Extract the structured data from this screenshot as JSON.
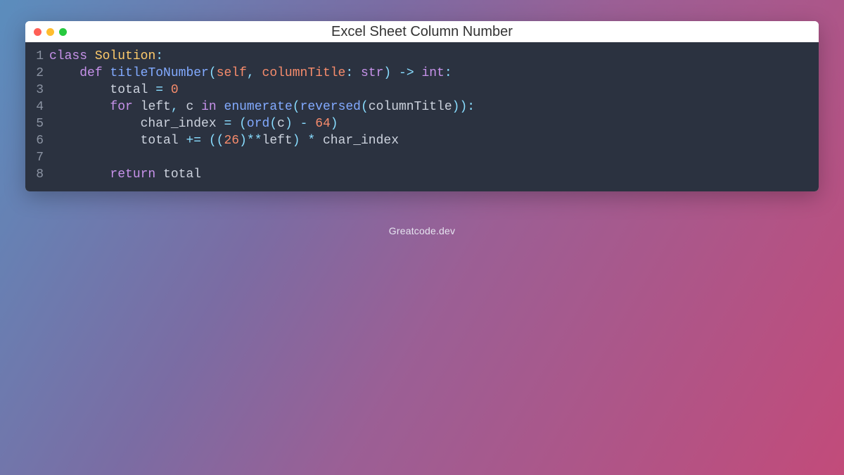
{
  "window": {
    "title": "Excel Sheet Column Number"
  },
  "footer": "Greatcode.dev",
  "code": {
    "line_numbers": [
      "1",
      "2",
      "3",
      "4",
      "5",
      "6",
      "7",
      "8"
    ],
    "l1": {
      "kw_class": "class",
      "cls": "Solution",
      "colon": ":"
    },
    "l2": {
      "indent": "    ",
      "kw_def": "def",
      "fn": "titleToNumber",
      "lp": "(",
      "self": "self",
      "comma": ",",
      "arg": "columnTitle",
      "colon1": ":",
      "typ_str": "str",
      "rp": ")",
      "arrow": "->",
      "typ_int": "int",
      "colon2": ":"
    },
    "l3": {
      "indent": "        ",
      "id": "total",
      "eq": "=",
      "zero": "0"
    },
    "l4": {
      "indent": "        ",
      "kw_for": "for",
      "left": "left",
      "comma": ",",
      "c": "c",
      "kw_in": "in",
      "enum": "enumerate",
      "lp": "(",
      "rev": "reversed",
      "lp2": "(",
      "arg": "columnTitle",
      "rp2": ")",
      "rp": ")",
      "colon": ":"
    },
    "l5": {
      "indent": "            ",
      "id": "char_index",
      "eq": "=",
      "lp": "(",
      "ord": "ord",
      "lp2": "(",
      "c": "c",
      "rp2": ")",
      "minus": "-",
      "n64": "64",
      "rp": ")"
    },
    "l6": {
      "indent": "            ",
      "id": "total",
      "pluseq": "+=",
      "lp": "((",
      "n26": "26",
      "rp1": ")",
      "pow": "**",
      "left": "left",
      "rp2": ")",
      "star": "*",
      "ci": "char_index"
    },
    "l8": {
      "indent": "        ",
      "kw_return": "return",
      "id": "total"
    }
  }
}
